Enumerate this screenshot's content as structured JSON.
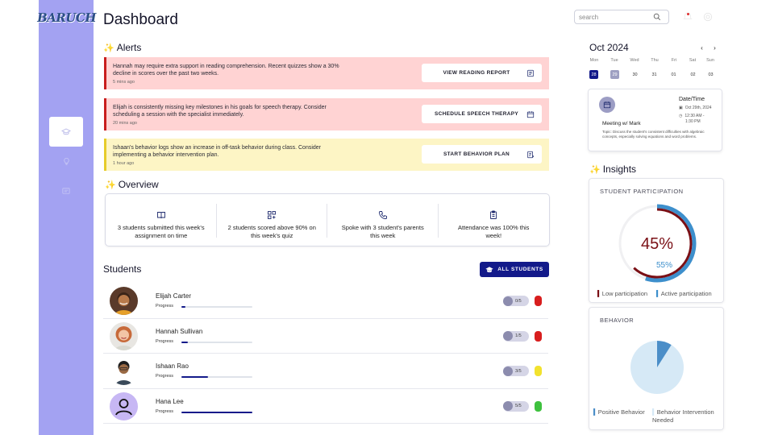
{
  "brand": {
    "logo_text": "BARUCH"
  },
  "header": {
    "title": "Dashboard",
    "search_placeholder": "search"
  },
  "alerts": {
    "title": "Alerts",
    "items": [
      {
        "text": "Hannah may require extra support in reading comprehension. Recent quizzes show a 30% decline in scores over the past two weeks.",
        "time": "5 mins ago",
        "button": "VIEW READING REPORT",
        "level": "red"
      },
      {
        "text": "Elijah is consistently missing key milestones in his goals for speech therapy. Consider scheduling a session with the specialist immediately.",
        "time": "20 mins ago",
        "button": "SCHEDULE SPEECH THERAPY",
        "level": "red"
      },
      {
        "text": "Ishaan's behavior logs show an increase in off-task behavior during class. Consider implementing a behavior intervention plan.",
        "time": "1 hour ago",
        "button": "START BEHAVIOR PLAN",
        "level": "yellow"
      }
    ]
  },
  "overview": {
    "title": "Overview",
    "items": [
      {
        "icon": "book-icon",
        "text": "3 students submitted this week's assignment on time"
      },
      {
        "icon": "grid-plus-icon",
        "text": "2 students scored above 90% on this week's quiz"
      },
      {
        "icon": "phone-icon",
        "text": "Spoke with 3 student's parents this week"
      },
      {
        "icon": "clipboard-icon",
        "text": "Attendance was 100% this week!"
      }
    ]
  },
  "students": {
    "title": "Students",
    "all_button": "ALL STUDENTS",
    "progress_label": "Progress",
    "rows": [
      {
        "name": "Elijah Carter",
        "progress": 0.06,
        "score": "0/5",
        "status_color": "#d81e1e"
      },
      {
        "name": "Hannah Sullivan",
        "progress": 0.09,
        "score": "1/5",
        "status_color": "#d81e1e"
      },
      {
        "name": "Ishaan Rao",
        "progress": 0.37,
        "score": "3/5",
        "status_color": "#f2e22e"
      },
      {
        "name": "Hana Lee",
        "progress": 1.0,
        "score": "5/5",
        "status_color": "#3ec13e"
      }
    ]
  },
  "calendar": {
    "month": "Oct 2024",
    "days": [
      "Mon",
      "Tue",
      "Wed",
      "Thu",
      "Fri",
      "Sat",
      "Sun"
    ],
    "dates": [
      "28",
      "29",
      "30",
      "31",
      "01",
      "02",
      "03"
    ]
  },
  "meeting": {
    "title": "Meeting w/ Mark",
    "datetime_label": "Date/Time",
    "date": "Oct 29th, 2024",
    "time": "12:30 AM -",
    "time_end": "1:30 PM",
    "topic": "Topic: Discuss the student's consistent difficulties with algebraic concepts, especially solving equations and word problems."
  },
  "insights": {
    "title": "Insights",
    "participation": {
      "title": "STUDENT PARTICIPATION",
      "value_label": "45%",
      "value": 45,
      "secondary_label": "55%",
      "secondary": 55,
      "legend_low": "Low participation",
      "legend_active": "Active participation",
      "colors": {
        "low": "#7a0f15",
        "active": "#3d8fcc"
      }
    },
    "behavior": {
      "title": "BEHAVIOR",
      "positive_fraction": 0.09,
      "legend_positive": "Positive Behavior",
      "legend_intervention": "Behavior Intervention Needed",
      "colors": {
        "positive": "#4b8ec8",
        "intervention": "#d6e9f6"
      }
    }
  }
}
